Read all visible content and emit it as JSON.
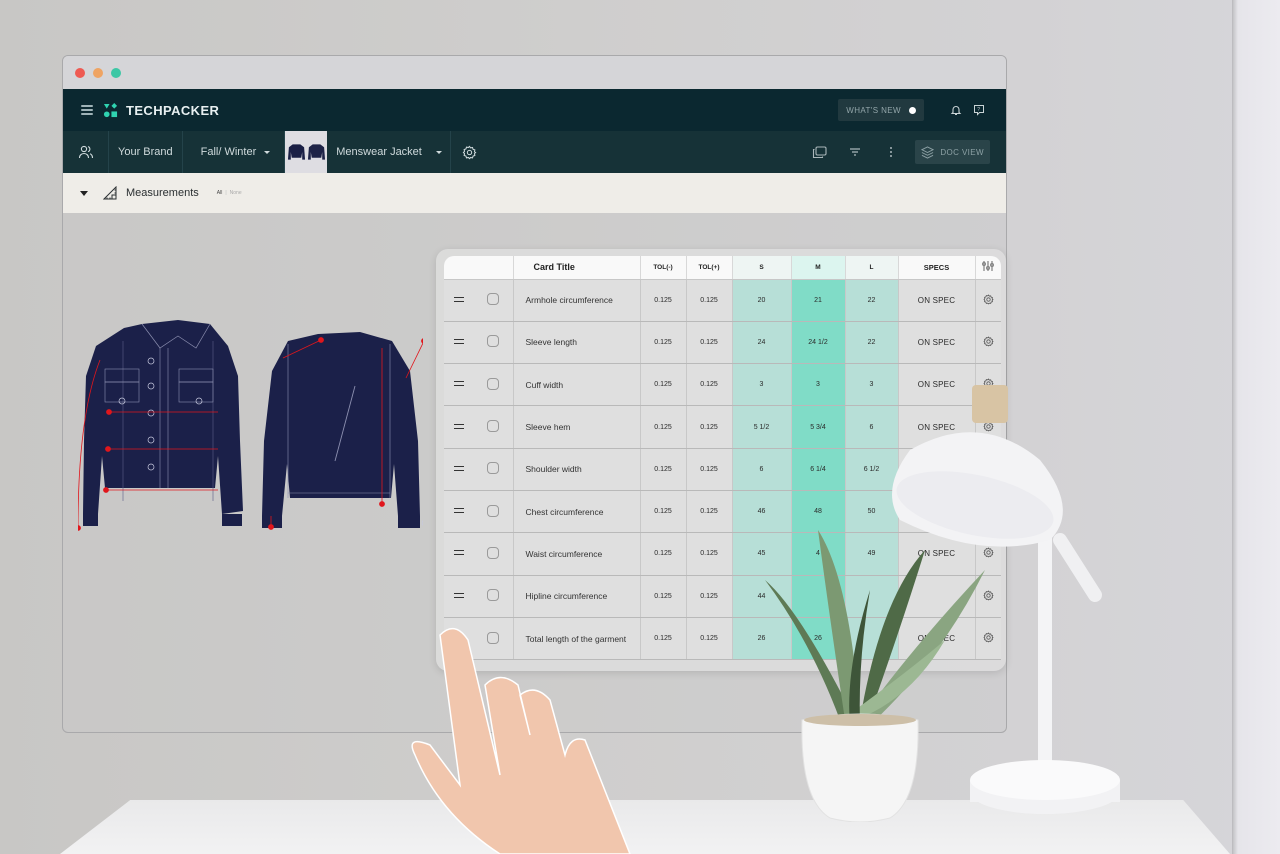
{
  "window": {
    "controls": [
      "close",
      "minimize",
      "maximize"
    ]
  },
  "appbar": {
    "brand": "TECHPACKER",
    "whats_new_label": "WHAT'S NEW",
    "icons": [
      "menu-icon",
      "bell-icon",
      "help-chat-icon"
    ]
  },
  "toolbar": {
    "brand": "Your Brand",
    "season": "Fall/ Winter",
    "product": "Menswear Jacket",
    "doc_view_label": "DOC VIEW",
    "icons": [
      "users-icon",
      "gear-icon",
      "copy-icon",
      "filter-icon",
      "more-vertical-icon",
      "layers-icon"
    ]
  },
  "section": {
    "title": "Measurements",
    "filter_all": "All",
    "filter_separator": "|",
    "filter_none": "None"
  },
  "table": {
    "headers": {
      "title": "Card Title",
      "tol_minus": "TOL(-)",
      "tol_plus": "TOL(+)",
      "s": "S",
      "m": "M",
      "l": "L",
      "specs": "SPECS"
    },
    "rows": [
      {
        "title": "Armhole circumference",
        "tol_minus": "0.125",
        "tol_plus": "0.125",
        "s": "20",
        "m": "21",
        "l": "22",
        "specs": "ON SPEC"
      },
      {
        "title": "Sleeve length",
        "tol_minus": "0.125",
        "tol_plus": "0.125",
        "s": "24",
        "m": "24 1/2",
        "l": "22",
        "specs": "ON SPEC"
      },
      {
        "title": "Cuff width",
        "tol_minus": "0.125",
        "tol_plus": "0.125",
        "s": "3",
        "m": "3",
        "l": "3",
        "specs": "ON SPEC"
      },
      {
        "title": "Sleeve hem",
        "tol_minus": "0.125",
        "tol_plus": "0.125",
        "s": "5 1/2",
        "m": "5 3/4",
        "l": "6",
        "specs": "ON SPEC"
      },
      {
        "title": "Shoulder width",
        "tol_minus": "0.125",
        "tol_plus": "0.125",
        "s": "6",
        "m": "6 1/4",
        "l": "6 1/2",
        "specs": ""
      },
      {
        "title": "Chest circumference",
        "tol_minus": "0.125",
        "tol_plus": "0.125",
        "s": "46",
        "m": "48",
        "l": "50",
        "specs": ""
      },
      {
        "title": "Waist circumference",
        "tol_minus": "0.125",
        "tol_plus": "0.125",
        "s": "45",
        "m": "4",
        "l": "49",
        "specs": "ON SPEC"
      },
      {
        "title": "Hipline circumference",
        "tol_minus": "0.125",
        "tol_plus": "0.125",
        "s": "44",
        "m": "",
        "l": "",
        "specs": ""
      },
      {
        "title": "Total length of the garment",
        "tol_minus": "0.125",
        "tol_plus": "0.125",
        "s": "26",
        "m": "26",
        "l": "",
        "specs": "ON SPEC"
      }
    ]
  },
  "colors": {
    "appbar_bg": "#0b2830",
    "toolbar_bg": "#163237",
    "section_bg": "#efede8",
    "accent_teal": "#2fd3b0",
    "size_m_fill": "#80dcc7",
    "size_sl_fill": "#b7dfd7",
    "jacket_navy": "#1a1f45",
    "measure_red": "#e0161c"
  }
}
